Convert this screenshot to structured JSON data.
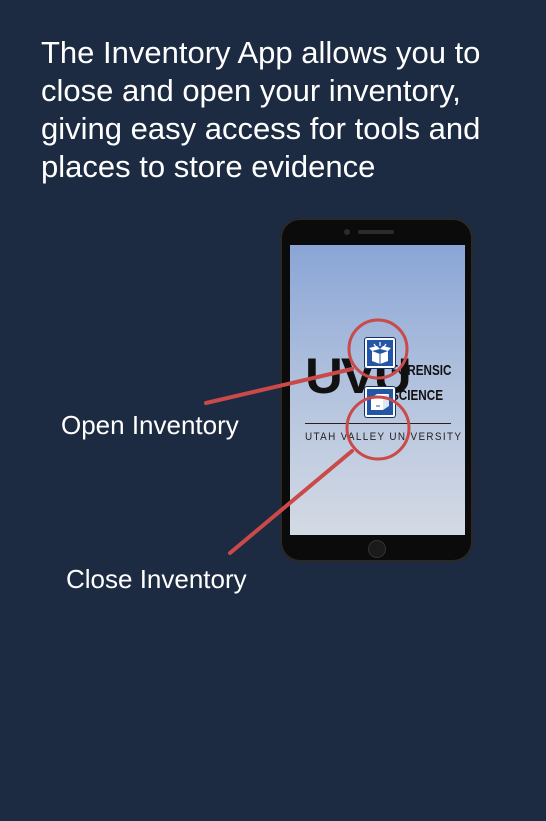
{
  "intro": {
    "text": "The Inventory App allows you to close and open your inventory, giving easy access for tools and places to store evidence"
  },
  "labels": {
    "open_inventory": "Open Inventory",
    "close_inventory": "Close Inventory"
  },
  "phone": {
    "logo": {
      "mark": "UVU",
      "line1": "FORENSIC",
      "line2": "SCIENCE",
      "university": "UTAH VALLEY UNIVERSITY"
    },
    "buttons": {
      "open_icon": "open-box-icon",
      "close_icon": "closed-box-icon"
    }
  },
  "colors": {
    "background": "#1c2b41",
    "annotation": "#c94a48",
    "button": "#2456a8"
  }
}
